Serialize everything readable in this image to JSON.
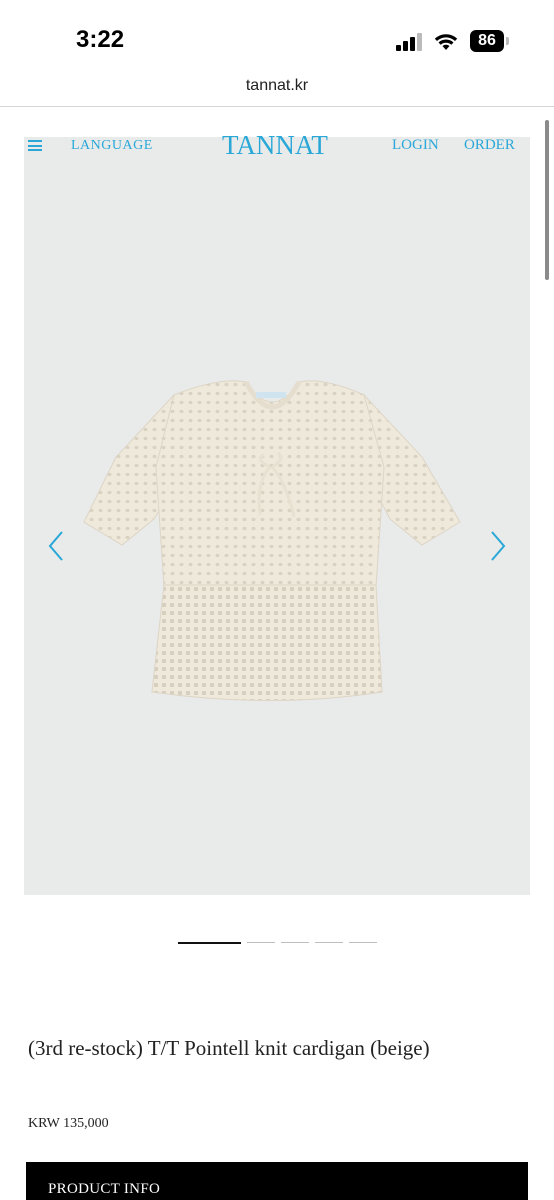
{
  "status_bar": {
    "time": "3:22",
    "battery": "86"
  },
  "browser": {
    "url": "tannat.kr"
  },
  "header": {
    "language": "LANGUAGE",
    "logo": "TANNAT",
    "login": "LOGIN",
    "order": "ORDER"
  },
  "carousel": {
    "total": 5,
    "active": 1
  },
  "product": {
    "title": "(3rd re-stock) T/T Pointell knit cardigan (beige)",
    "price": "KRW 135,000",
    "info_label": "PRODUCT INFO"
  },
  "colors": {
    "accent": "#29a8d8",
    "background": "#e9eaea",
    "garment": "#efe9dc"
  }
}
